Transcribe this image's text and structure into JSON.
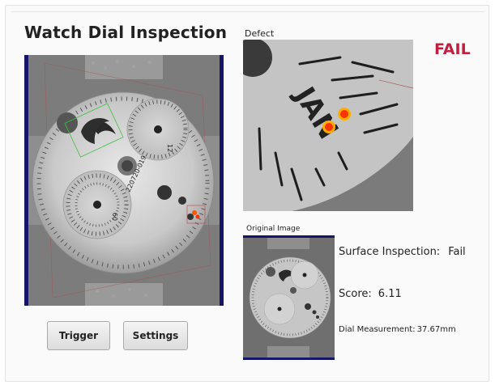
{
  "title": "Watch Dial Inspection",
  "result": {
    "text": "FAIL",
    "color": "#c0203f"
  },
  "defect_view": {
    "label": "Defect"
  },
  "original_view": {
    "label": "Original Image"
  },
  "dial_text": {
    "date_code": "220720-019",
    "lower_numbers": "09",
    "top_numbers": "12",
    "defect_letters": "JAN"
  },
  "inspection": {
    "surface_label": "Surface Inspection:",
    "surface_value": "Fail",
    "score_label": "Score:",
    "score_value": "6.11",
    "dial_label": "Dial Measurement:",
    "dial_value": "37.67mm"
  },
  "buttons": {
    "trigger": "Trigger",
    "settings": "Settings"
  },
  "colors": {
    "frame": "#15156a",
    "defect_marker": "#ff3300",
    "roi_box": "#3fbf3f"
  }
}
